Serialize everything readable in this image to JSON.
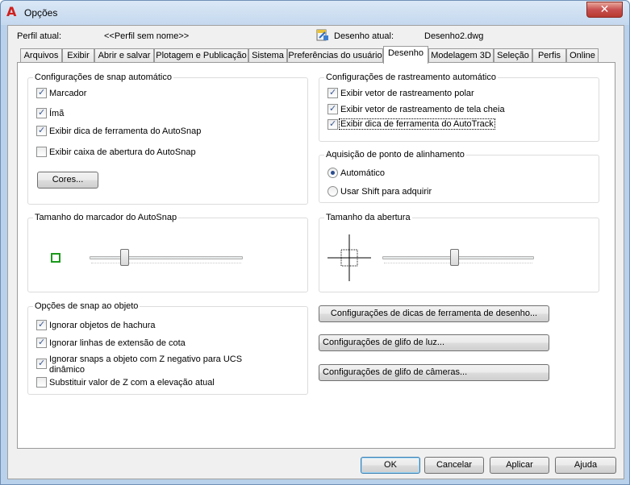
{
  "window": {
    "title": "Opções",
    "close_label": "✕"
  },
  "profile": {
    "label": "Perfil atual:",
    "value": "<<Perfil sem nome>>"
  },
  "drawing": {
    "label": "Desenho atual:",
    "value": "Desenho2.dwg"
  },
  "tabs": [
    {
      "label": "Arquivos"
    },
    {
      "label": "Exibir"
    },
    {
      "label": "Abrir e salvar"
    },
    {
      "label": "Plotagem e Publicação"
    },
    {
      "label": "Sistema"
    },
    {
      "label": "Preferências do usuário"
    },
    {
      "label": "Desenho"
    },
    {
      "label": "Modelagem 3D"
    },
    {
      "label": "Seleção"
    },
    {
      "label": "Perfis"
    },
    {
      "label": "Online"
    }
  ],
  "active_tab": "Desenho",
  "autosnap": {
    "title": "Configurações de snap automático",
    "options": [
      {
        "label": "Marcador",
        "checked": true
      },
      {
        "label": "Ímã",
        "checked": true
      },
      {
        "label": "Exibir dica de ferramenta do AutoSnap",
        "checked": true
      },
      {
        "label": "Exibir caixa de abertura do AutoSnap",
        "checked": false
      }
    ],
    "colors_button": "Cores..."
  },
  "autotrack": {
    "title": "Configurações de rastreamento automático",
    "options": [
      {
        "label": "Exibir vetor de rastreamento polar",
        "checked": true
      },
      {
        "label": "Exibir vetor de rastreamento de tela cheia",
        "checked": true
      },
      {
        "label": "Exibir dica de ferramenta do AutoTrack",
        "checked": true
      }
    ]
  },
  "alignment": {
    "title": "Aquisição de ponto de alinhamento",
    "options": [
      {
        "label": "Automático",
        "selected": true
      },
      {
        "label": "Usar Shift para adquirir",
        "selected": false
      }
    ]
  },
  "marker_size": {
    "title": "Tamanho do marcador do AutoSnap",
    "value_fraction": 0.22
  },
  "aperture_size": {
    "title": "Tamanho da abertura",
    "value_fraction": 0.47
  },
  "object_snap": {
    "title": "Opções de snap ao objeto",
    "options": [
      {
        "label": "Ignorar objetos de hachura",
        "checked": true
      },
      {
        "label": "Ignorar linhas de extensão de cota",
        "checked": true
      },
      {
        "label": "Ignorar snaps a objeto com Z negativo para UCS",
        "label2": "dinâmico",
        "checked": true
      },
      {
        "label": "Substituir valor de Z com a elevação atual",
        "checked": false
      }
    ]
  },
  "right_buttons": [
    {
      "label": "Configurações de dicas de ferramenta de desenho..."
    },
    {
      "label": "Configurações de glifo de luz..."
    },
    {
      "label": "Configurações de glifo de câmeras..."
    }
  ],
  "footer": {
    "ok": "OK",
    "cancel": "Cancelar",
    "apply": "Aplicar",
    "help": "Ajuda"
  },
  "colors": {
    "marker": "#1a9a1a",
    "app_icon": "#d0201c"
  }
}
